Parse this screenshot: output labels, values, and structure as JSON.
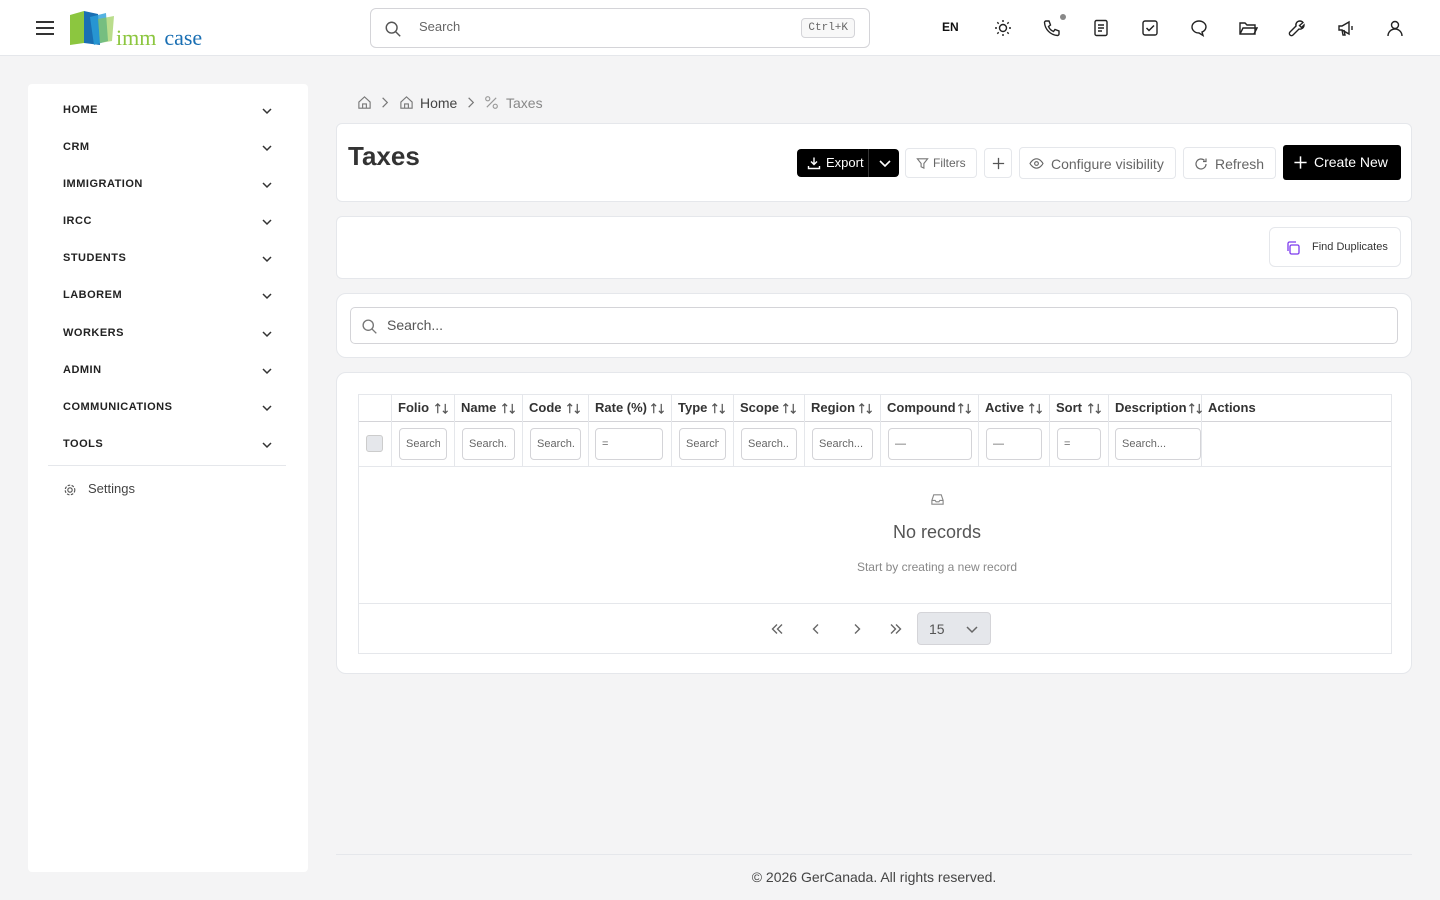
{
  "header": {
    "logo": {
      "word1": "imm",
      "word2": "case",
      "brand_green": "#8cc63f",
      "brand_blue": "#1a6fb3"
    },
    "search": {
      "placeholder": "Search",
      "shortcut": "Ctrl+K"
    },
    "language": "EN",
    "icons": [
      "theme-sun-icon",
      "phone-icon",
      "notes-icon",
      "tasks-check-icon",
      "chat-icon",
      "folder-icon",
      "tools-wrench-icon",
      "megaphone-icon",
      "user-icon"
    ]
  },
  "sidebar": {
    "items": [
      {
        "label": "HOME"
      },
      {
        "label": "CRM"
      },
      {
        "label": "IMMIGRATION"
      },
      {
        "label": "IRCC"
      },
      {
        "label": "STUDENTS"
      },
      {
        "label": "LABOREM"
      },
      {
        "label": "WORKERS"
      },
      {
        "label": "ADMIN"
      },
      {
        "label": "COMMUNICATIONS"
      },
      {
        "label": "TOOLS"
      }
    ],
    "settings_label": "Settings"
  },
  "breadcrumb": {
    "home": "Home",
    "current": "Taxes"
  },
  "page": {
    "title": "Taxes",
    "actions": {
      "export": "Export",
      "filters": "Filters",
      "configure": "Configure visibility",
      "refresh": "Refresh",
      "create": "Create New",
      "find_duplicates": "Find Duplicates"
    },
    "search_placeholder": "Search..."
  },
  "table": {
    "columns": [
      "Folio",
      "Name",
      "Code",
      "Rate (%)",
      "Type",
      "Scope",
      "Region",
      "Compound",
      "Active",
      "Sort",
      "Description",
      "Actions"
    ],
    "filters": {
      "folio": "Search...",
      "name": "Search...",
      "code": "Search...",
      "rate": "=",
      "type": "Search...",
      "scope": "Search...",
      "region": "Search...",
      "compound": "—",
      "active": "—",
      "sort": "=",
      "description": "Search..."
    },
    "empty_title": "No records",
    "empty_subtitle": "Start by creating a new record",
    "page_size": "15"
  },
  "footer": "© 2026 GerCanada. All rights reserved."
}
